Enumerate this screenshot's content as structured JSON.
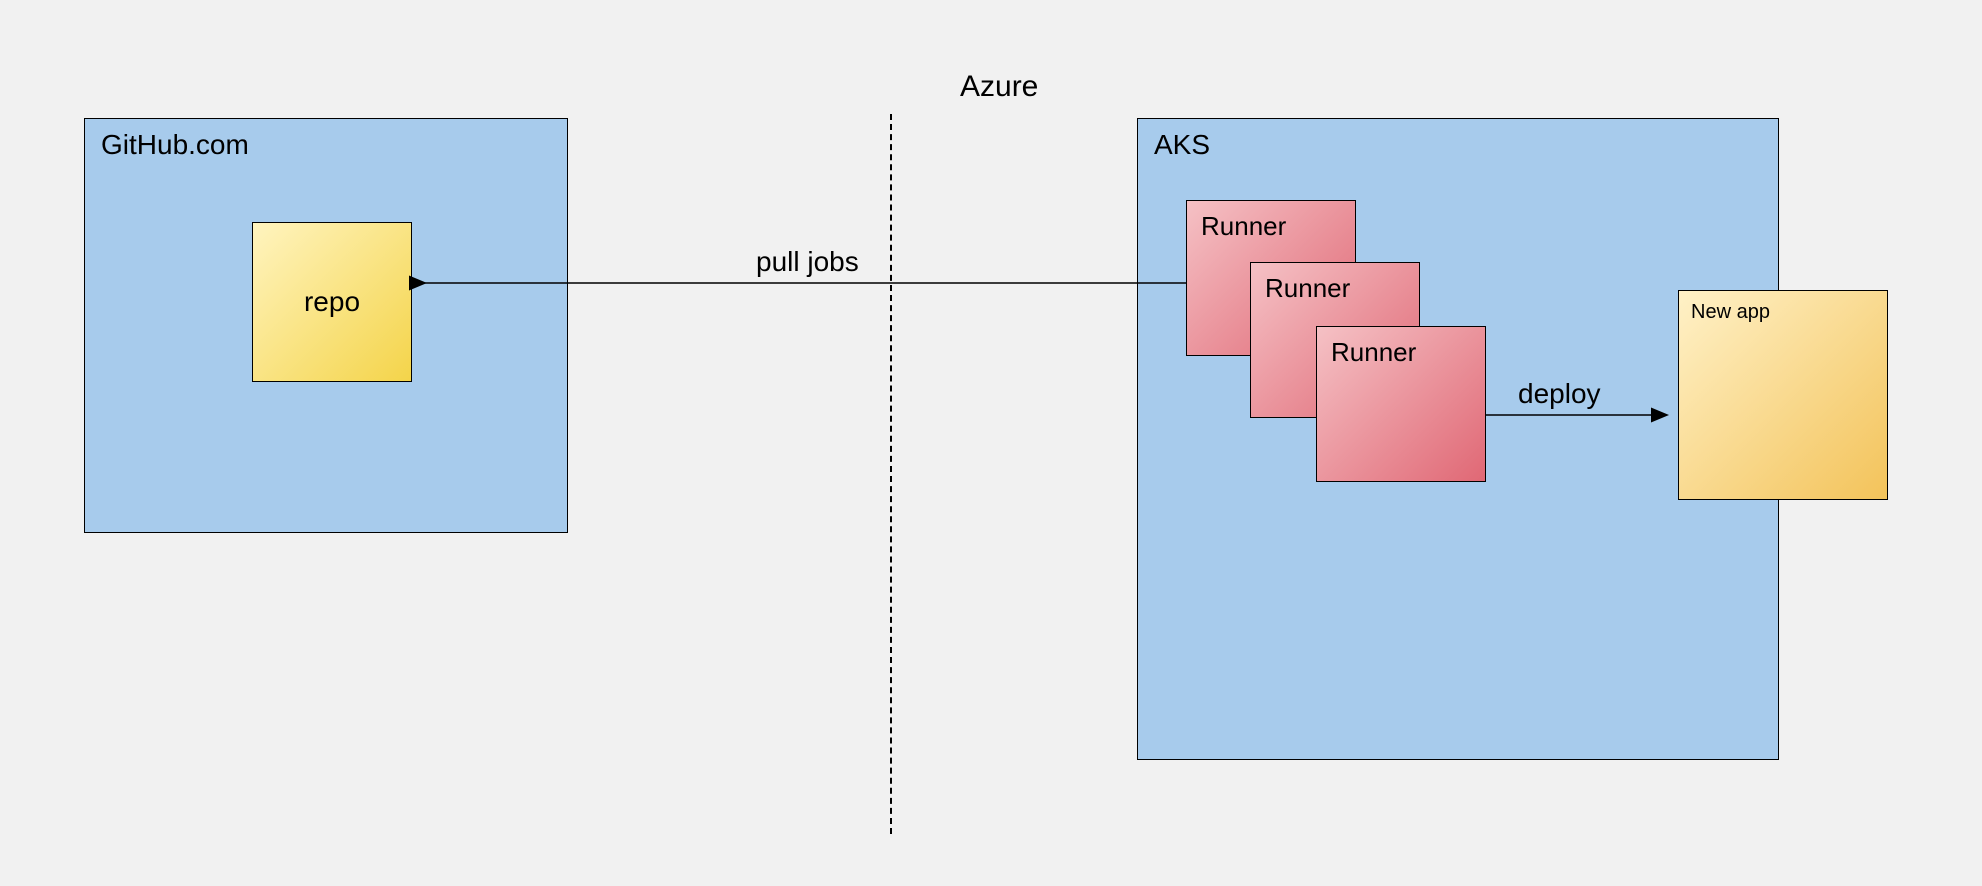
{
  "diagram": {
    "azure_label": "Azure",
    "github": {
      "title": "GitHub.com",
      "repo_label": "repo"
    },
    "aks": {
      "title": "AKS",
      "runners": [
        "Runner",
        "Runner",
        "Runner"
      ],
      "new_app_label": "New app"
    },
    "arrows": {
      "pull_jobs": "pull jobs",
      "deploy": "deploy"
    }
  }
}
